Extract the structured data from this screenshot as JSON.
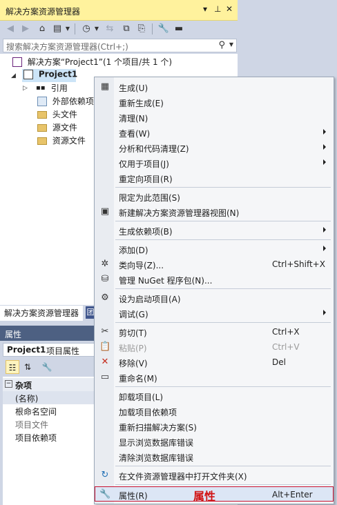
{
  "solution_explorer": {
    "title": "解决方案资源管理器",
    "title_controls": [
      "▾",
      "⊥",
      "✕"
    ],
    "search_placeholder": "搜索解决方案资源管理器(Ctrl+;)",
    "tree": {
      "solution": "解决方案“Project1”(1 个项目/共 1 个)",
      "project": "Project1",
      "children": [
        "引用",
        "外部依赖项",
        "头文件",
        "源文件",
        "资源文件"
      ]
    },
    "tab_active": "解决方案资源管理器",
    "tab_inactive_glyph": "团"
  },
  "properties": {
    "title": "属性",
    "object_name": "Project1",
    "object_kind": "项目属性",
    "category": "杂项",
    "rows": [
      "(名称)",
      "根命名空间",
      "项目文件",
      "项目依赖项"
    ]
  },
  "context_menu": {
    "items": [
      {
        "label": "生成(U)",
        "shortcut": "",
        "icon": "build-icon",
        "glyph": "▦",
        "submenu": false,
        "disabled": false
      },
      {
        "label": "重新生成(E)",
        "shortcut": "",
        "icon": "",
        "glyph": "",
        "submenu": false,
        "disabled": false
      },
      {
        "label": "清理(N)",
        "shortcut": "",
        "icon": "",
        "glyph": "",
        "submenu": false,
        "disabled": false
      },
      {
        "label": "查看(W)",
        "shortcut": "",
        "icon": "",
        "glyph": "",
        "submenu": true,
        "disabled": false
      },
      {
        "label": "分析和代码清理(Z)",
        "shortcut": "",
        "icon": "",
        "glyph": "",
        "submenu": true,
        "disabled": false
      },
      {
        "label": "仅用于项目(J)",
        "shortcut": "",
        "icon": "",
        "glyph": "",
        "submenu": true,
        "disabled": false
      },
      {
        "label": "重定向项目(R)",
        "shortcut": "",
        "icon": "",
        "glyph": "",
        "submenu": false,
        "disabled": false
      },
      {
        "sep": true
      },
      {
        "label": "限定为此范围(S)",
        "shortcut": "",
        "icon": "",
        "glyph": "",
        "submenu": false,
        "disabled": false
      },
      {
        "label": "新建解决方案资源管理器视图(N)",
        "shortcut": "",
        "icon": "new-view-icon",
        "glyph": "▣",
        "submenu": false,
        "disabled": false
      },
      {
        "sep": true
      },
      {
        "label": "生成依赖项(B)",
        "shortcut": "",
        "icon": "",
        "glyph": "",
        "submenu": true,
        "disabled": false
      },
      {
        "sep": true
      },
      {
        "label": "添加(D)",
        "shortcut": "",
        "icon": "",
        "glyph": "",
        "submenu": true,
        "disabled": false
      },
      {
        "label": "类向导(Z)...",
        "shortcut": "Ctrl+Shift+X",
        "icon": "class-wizard-icon",
        "glyph": "✲",
        "submenu": false,
        "disabled": false
      },
      {
        "label": "管理 NuGet 程序包(N)...",
        "shortcut": "",
        "icon": "nuget-icon",
        "glyph": "⛁",
        "submenu": false,
        "disabled": false
      },
      {
        "sep": true
      },
      {
        "label": "设为启动项目(A)",
        "shortcut": "",
        "icon": "gear-icon",
        "glyph": "⚙",
        "submenu": false,
        "disabled": false
      },
      {
        "label": "调试(G)",
        "shortcut": "",
        "icon": "",
        "glyph": "",
        "submenu": true,
        "disabled": false
      },
      {
        "sep": true
      },
      {
        "label": "剪切(T)",
        "shortcut": "Ctrl+X",
        "icon": "scissors-icon",
        "glyph": "✂",
        "submenu": false,
        "disabled": false
      },
      {
        "label": "粘贴(P)",
        "shortcut": "Ctrl+V",
        "icon": "paste-icon",
        "glyph": "📋",
        "submenu": false,
        "disabled": true
      },
      {
        "label": "移除(V)",
        "shortcut": "Del",
        "icon": "remove-icon",
        "glyph": "✕",
        "submenu": false,
        "disabled": false
      },
      {
        "label": "重命名(M)",
        "shortcut": "",
        "icon": "rename-icon",
        "glyph": "▭",
        "submenu": false,
        "disabled": false
      },
      {
        "sep": true
      },
      {
        "label": "卸载项目(L)",
        "shortcut": "",
        "icon": "",
        "glyph": "",
        "submenu": false,
        "disabled": false
      },
      {
        "label": "加载项目依赖项",
        "shortcut": "",
        "icon": "",
        "glyph": "",
        "submenu": false,
        "disabled": false
      },
      {
        "label": "重新扫描解决方案(S)",
        "shortcut": "",
        "icon": "",
        "glyph": "",
        "submenu": false,
        "disabled": false
      },
      {
        "label": "显示浏览数据库错误",
        "shortcut": "",
        "icon": "",
        "glyph": "",
        "submenu": false,
        "disabled": false
      },
      {
        "label": "清除浏览数据库错误",
        "shortcut": "",
        "icon": "",
        "glyph": "",
        "submenu": false,
        "disabled": false
      },
      {
        "sep": true
      },
      {
        "label": "在文件资源管理器中打开文件夹(X)",
        "shortcut": "",
        "icon": "open-folder-icon",
        "glyph": "↻",
        "submenu": false,
        "disabled": false
      },
      {
        "sep": true
      },
      {
        "label": "属性(R)",
        "shortcut": "Alt+Enter",
        "icon": "wrench-icon",
        "glyph": "🔧",
        "submenu": false,
        "disabled": false,
        "highlight": true
      }
    ],
    "annotation": "属性"
  },
  "colors": {
    "title_active": "#fff29d",
    "panel_bg": "#cfd6e5",
    "properties_title": "#4d6082",
    "highlight_border": "#c8102e",
    "annotation": "#d11212"
  }
}
